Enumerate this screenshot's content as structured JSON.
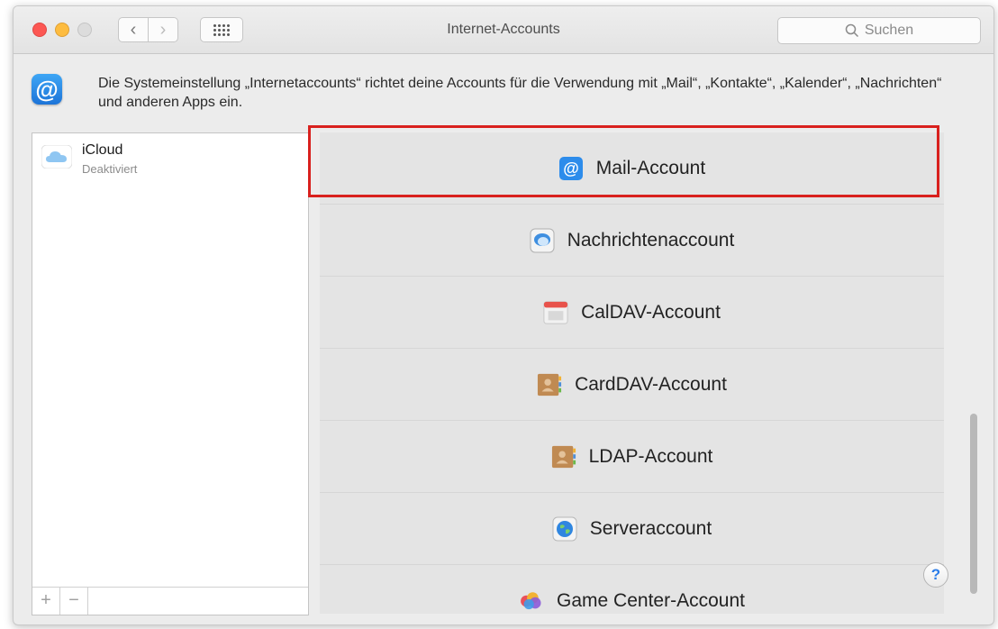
{
  "window": {
    "title": "Internet-Accounts",
    "search_placeholder": "Suchen"
  },
  "info": {
    "text": "Die Systemeinstellung „Internetaccounts“ richtet deine Accounts für die Verwendung mit „Mail“, „Kontakte“, „Kalender“, „Nachrichten“ und anderen Apps ein."
  },
  "accounts": [
    {
      "name": "iCloud",
      "status": "Deaktiviert",
      "icon": "icloud-icon"
    }
  ],
  "account_controls": {
    "add": "+",
    "remove": "−"
  },
  "providers": [
    {
      "label": "Mail-Account",
      "icon": "mail-at-icon",
      "highlighted": true
    },
    {
      "label": "Nachrichtenaccount",
      "icon": "messages-icon"
    },
    {
      "label": "CalDAV-Account",
      "icon": "calendar-icon"
    },
    {
      "label": "CardDAV-Account",
      "icon": "contacts-icon"
    },
    {
      "label": "LDAP-Account",
      "icon": "contacts-icon"
    },
    {
      "label": "Serveraccount",
      "icon": "server-globe-icon"
    },
    {
      "label": "Game Center-Account",
      "icon": "game-center-icon"
    }
  ],
  "help_label": "?",
  "colors": {
    "highlight": "#d9211e",
    "accent": "#2a7ce8"
  }
}
